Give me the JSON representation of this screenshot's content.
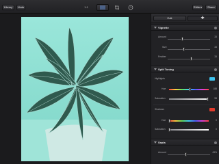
{
  "toolbar": {
    "library_label": "Library",
    "undo_label": "Undo",
    "ratio_label": "1:1",
    "edits_label": "Edits",
    "share_label": "Share"
  },
  "panel": {
    "tab_edit": "Edit",
    "tab_add": "✚",
    "vignette": {
      "title": "Vignette",
      "amount_label": "Amount",
      "amount_value": "33",
      "size_label": "Size",
      "size_value": "33",
      "feather_label": "Feather",
      "feather_value": "33",
      "amount_level": 0.35,
      "size_level": 0.38,
      "feather_level": 0.55
    },
    "split_toning": {
      "title": "Split Toning",
      "highlights_label": "Highlights",
      "highlights_color": "#3fc3ee",
      "hue_label": "Hue",
      "hue_value": "188",
      "saturation_label": "Saturation",
      "saturation_value": "98",
      "shadows_label": "Shadows",
      "shadows_color": "#e03b2c",
      "shadow_hue_label": "Hue",
      "shadow_hue_value": "0",
      "shadow_saturation_label": "Saturation",
      "shadow_saturation_value": "0",
      "hue_level": 0.52,
      "saturation_level": 0.98,
      "shadow_hue_level": 0.0,
      "shadow_saturation_level": 0.0
    },
    "sepia": {
      "title": "Sepia",
      "amount_label": "Amount",
      "amount_value": "43%",
      "amount_level": 0.43
    }
  }
}
